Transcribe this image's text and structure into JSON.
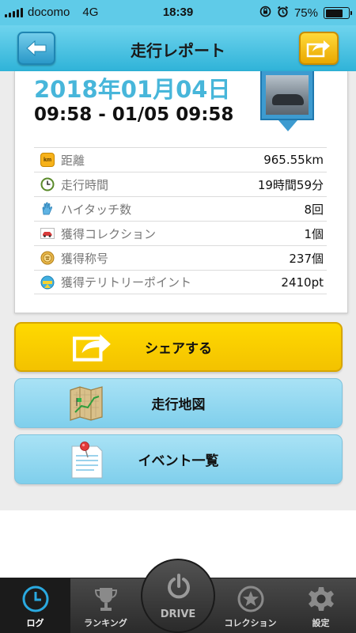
{
  "status": {
    "carrier": "docomo",
    "network": "4G",
    "time": "18:39",
    "battery": "75%",
    "battery_level": 0.75
  },
  "header": {
    "title": "走行レポート",
    "back_icon": "back-arrow-icon",
    "share_icon": "share-icon"
  },
  "report": {
    "date": "2018年01月04日",
    "time_range": "09:58 - 01/05 09:58",
    "stats": [
      {
        "icon": "km-icon",
        "icon_text": "km",
        "label": "距離",
        "value": "965.55km"
      },
      {
        "icon": "clock-icon",
        "label": "走行時間",
        "value": "19時間59分"
      },
      {
        "icon": "hand-icon",
        "label": "ハイタッチ数",
        "value": "8回"
      },
      {
        "icon": "car-icon",
        "label": "獲得コレクション",
        "value": "1個"
      },
      {
        "icon": "title-badge-icon",
        "label": "獲得称号",
        "value": "237個"
      },
      {
        "icon": "spot-icon",
        "label": "獲得テリトリーポイント",
        "value": "2410pt"
      }
    ]
  },
  "actions": {
    "share": "シェアする",
    "map": "走行地図",
    "events": "イベント一覧"
  },
  "tabs": {
    "log": "ログ",
    "ranking": "ランキング",
    "drive": "DRIVE",
    "collection": "コレクション",
    "settings": "設定"
  },
  "colors": {
    "accent_blue": "#47b6da",
    "header_blue": "#2fb3d8",
    "share_yellow": "#f3c200"
  }
}
